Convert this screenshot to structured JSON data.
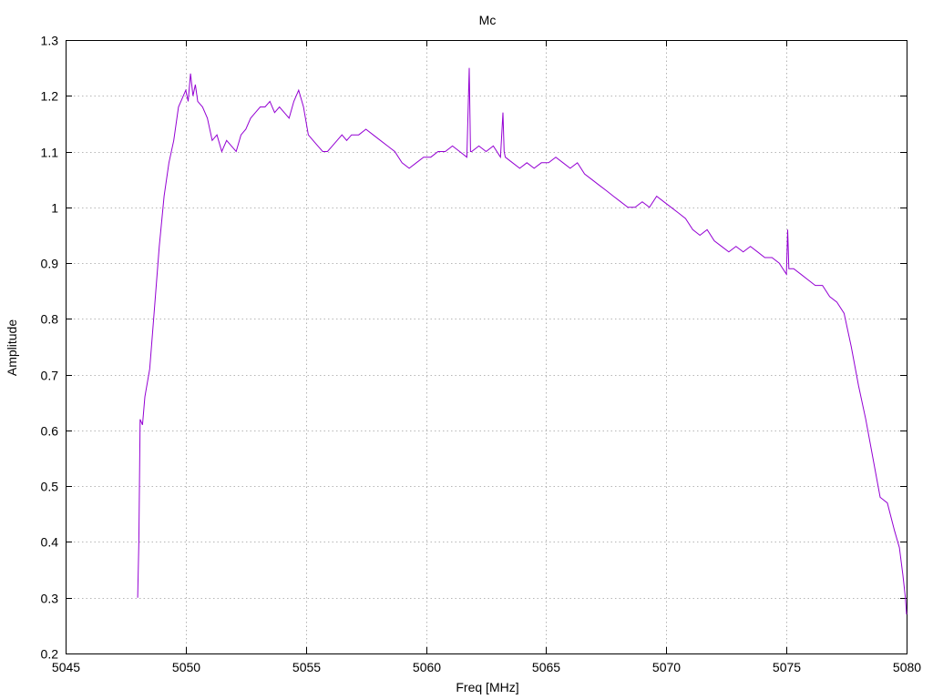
{
  "chart_data": {
    "type": "line",
    "title": "Mc",
    "xlabel": "Freq [MHz]",
    "ylabel": "Amplitude",
    "xlim": [
      5045,
      5080
    ],
    "ylim": [
      0.2,
      1.3
    ],
    "xticks": [
      5045,
      5050,
      5055,
      5060,
      5065,
      5070,
      5075,
      5080
    ],
    "yticks": [
      0.2,
      0.3,
      0.4,
      0.5,
      0.6,
      0.7,
      0.8,
      0.9,
      1,
      1.1,
      1.2,
      1.3
    ],
    "xtick_labels": [
      "5045",
      "5050",
      "5055",
      "5060",
      "5065",
      "5070",
      "5075",
      "5080"
    ],
    "ytick_labels": [
      "0.2",
      "0.3",
      "0.4",
      "0.5",
      "0.6",
      "0.7",
      "0.8",
      "0.9",
      "1",
      "1.1",
      "1.2",
      "1.3"
    ],
    "grid": true,
    "color": "#9400d3",
    "series": [
      {
        "x": [
          5048.0,
          5048.05,
          5048.1,
          5048.2,
          5048.3,
          5048.5,
          5048.7,
          5048.9,
          5049.1,
          5049.3,
          5049.5,
          5049.7,
          5049.9,
          5050.0,
          5050.1,
          5050.2,
          5050.3,
          5050.4,
          5050.5,
          5050.7,
          5050.9,
          5051.1,
          5051.3,
          5051.5,
          5051.7,
          5051.9,
          5052.1,
          5052.3,
          5052.5,
          5052.7,
          5052.9,
          5053.1,
          5053.3,
          5053.5,
          5053.7,
          5053.9,
          5054.1,
          5054.3,
          5054.5,
          5054.7,
          5054.9,
          5055.1,
          5055.3,
          5055.5,
          5055.7,
          5055.9,
          5056.1,
          5056.3,
          5056.5,
          5056.7,
          5056.9,
          5057.2,
          5057.5,
          5057.8,
          5058.1,
          5058.4,
          5058.7,
          5059.0,
          5059.3,
          5059.6,
          5059.9,
          5060.2,
          5060.5,
          5060.8,
          5061.1,
          5061.4,
          5061.7,
          5061.8,
          5061.85,
          5061.9,
          5062.2,
          5062.5,
          5062.8,
          5063.1,
          5063.2,
          5063.25,
          5063.3,
          5063.6,
          5063.9,
          5064.2,
          5064.5,
          5064.8,
          5065.1,
          5065.4,
          5065.7,
          5066.0,
          5066.3,
          5066.6,
          5066.9,
          5067.2,
          5067.5,
          5067.8,
          5068.1,
          5068.4,
          5068.7,
          5069.0,
          5069.3,
          5069.6,
          5069.9,
          5070.2,
          5070.5,
          5070.8,
          5071.1,
          5071.4,
          5071.7,
          5072.0,
          5072.3,
          5072.6,
          5072.9,
          5073.2,
          5073.5,
          5073.8,
          5074.1,
          5074.4,
          5074.7,
          5075.0,
          5075.05,
          5075.1,
          5075.3,
          5075.6,
          5075.9,
          5076.2,
          5076.5,
          5076.8,
          5077.1,
          5077.4,
          5077.7,
          5078.0,
          5078.3,
          5078.6,
          5078.9,
          5079.2,
          5079.5,
          5079.7,
          5079.85,
          5079.95,
          5080.0
        ],
        "y": [
          0.3,
          0.4,
          0.62,
          0.61,
          0.66,
          0.71,
          0.82,
          0.93,
          1.02,
          1.08,
          1.12,
          1.18,
          1.2,
          1.21,
          1.19,
          1.24,
          1.2,
          1.22,
          1.19,
          1.18,
          1.16,
          1.12,
          1.13,
          1.1,
          1.12,
          1.11,
          1.1,
          1.13,
          1.14,
          1.16,
          1.17,
          1.18,
          1.18,
          1.19,
          1.17,
          1.18,
          1.17,
          1.16,
          1.19,
          1.21,
          1.18,
          1.13,
          1.12,
          1.11,
          1.1,
          1.1,
          1.11,
          1.12,
          1.13,
          1.12,
          1.13,
          1.13,
          1.14,
          1.13,
          1.12,
          1.11,
          1.1,
          1.08,
          1.07,
          1.08,
          1.09,
          1.09,
          1.1,
          1.1,
          1.11,
          1.1,
          1.09,
          1.25,
          1.1,
          1.1,
          1.11,
          1.1,
          1.11,
          1.09,
          1.17,
          1.1,
          1.09,
          1.08,
          1.07,
          1.08,
          1.07,
          1.08,
          1.08,
          1.09,
          1.08,
          1.07,
          1.08,
          1.06,
          1.05,
          1.04,
          1.03,
          1.02,
          1.01,
          1.0,
          1.0,
          1.01,
          1.0,
          1.02,
          1.01,
          1.0,
          0.99,
          0.98,
          0.96,
          0.95,
          0.96,
          0.94,
          0.93,
          0.92,
          0.93,
          0.92,
          0.93,
          0.92,
          0.91,
          0.91,
          0.9,
          0.88,
          0.96,
          0.89,
          0.89,
          0.88,
          0.87,
          0.86,
          0.86,
          0.84,
          0.83,
          0.81,
          0.75,
          0.68,
          0.62,
          0.55,
          0.48,
          0.47,
          0.42,
          0.39,
          0.34,
          0.3,
          0.27
        ]
      }
    ]
  }
}
